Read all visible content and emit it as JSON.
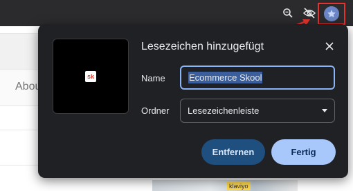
{
  "toolbar": {
    "icons": [
      "zoom-icon",
      "eye-off-icon",
      "star-icon"
    ],
    "highlight_color": "#e3342f",
    "star_bg": "#6b86c6"
  },
  "background_page": {
    "about_label": "Abou",
    "tag_text": "klaviyo"
  },
  "dialog": {
    "title": "Lesezeichen hinzugefügt",
    "thumbnail_logo": "sk",
    "name_label": "Name",
    "name_value": "Ecommerce Skool",
    "folder_label": "Ordner",
    "folder_value": "Lesezeichenleiste",
    "remove_button": "Entfernen",
    "done_button": "Fertig",
    "accent": "#8ab4f8"
  }
}
